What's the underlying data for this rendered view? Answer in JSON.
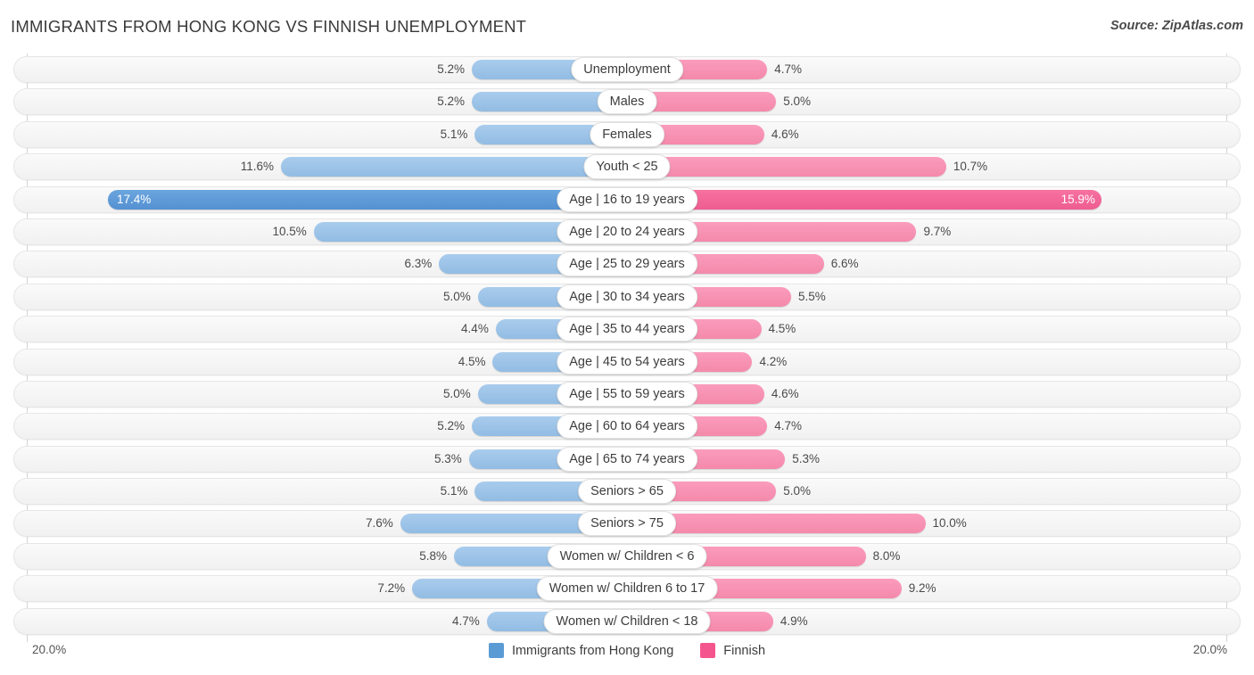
{
  "header": {
    "title": "IMMIGRANTS FROM HONG KONG VS FINNISH UNEMPLOYMENT",
    "source": "Source: ZipAtlas.com"
  },
  "legend": {
    "items": [
      {
        "label": "Immigrants from Hong Kong",
        "color": "#5b9bd5",
        "swatch": "blue"
      },
      {
        "label": "Finnish",
        "color": "#f5558d",
        "swatch": "pink"
      }
    ]
  },
  "axis": {
    "left_max_label": "20.0%",
    "right_max_label": "20.0%",
    "max_value": 20.0
  },
  "colors": {
    "left_bar": "#9dc3e6",
    "left_bar_highlight": "#5b9bd5",
    "right_bar": "#f791b3",
    "right_bar_highlight": "#f2649a",
    "track": "#f4f4f4",
    "text": "#4a4a4a"
  },
  "chart_data": {
    "type": "bar",
    "orientation": "diverging-horizontal",
    "title": "IMMIGRANTS FROM HONG KONG VS FINNISH UNEMPLOYMENT",
    "xlabel": "",
    "ylabel": "",
    "xlim": [
      20.0,
      20.0
    ],
    "grid": false,
    "legend_position": "bottom-center",
    "categories": [
      "Unemployment",
      "Males",
      "Females",
      "Youth < 25",
      "Age | 16 to 19 years",
      "Age | 20 to 24 years",
      "Age | 25 to 29 years",
      "Age | 30 to 34 years",
      "Age | 35 to 44 years",
      "Age | 45 to 54 years",
      "Age | 55 to 59 years",
      "Age | 60 to 64 years",
      "Age | 65 to 74 years",
      "Seniors > 65",
      "Seniors > 75",
      "Women w/ Children < 6",
      "Women w/ Children 6 to 17",
      "Women w/ Children < 18"
    ],
    "series": [
      {
        "name": "Immigrants from Hong Kong",
        "side": "left",
        "values": [
          5.2,
          5.2,
          5.1,
          11.6,
          17.4,
          10.5,
          6.3,
          5.0,
          4.4,
          4.5,
          5.0,
          5.2,
          5.3,
          5.1,
          7.6,
          5.8,
          7.2,
          4.7
        ],
        "labels": [
          "5.2%",
          "5.2%",
          "5.1%",
          "11.6%",
          "17.4%",
          "10.5%",
          "6.3%",
          "5.0%",
          "4.4%",
          "4.5%",
          "5.0%",
          "5.2%",
          "5.3%",
          "5.1%",
          "7.6%",
          "5.8%",
          "7.2%",
          "4.7%"
        ]
      },
      {
        "name": "Finnish",
        "side": "right",
        "values": [
          4.7,
          5.0,
          4.6,
          10.7,
          15.9,
          9.7,
          6.6,
          5.5,
          4.5,
          4.2,
          4.6,
          4.7,
          5.3,
          5.0,
          10.0,
          8.0,
          9.2,
          4.9
        ],
        "labels": [
          "4.7%",
          "5.0%",
          "4.6%",
          "10.7%",
          "15.9%",
          "9.7%",
          "6.6%",
          "5.5%",
          "4.5%",
          "4.2%",
          "4.6%",
          "4.7%",
          "5.3%",
          "5.0%",
          "10.0%",
          "8.0%",
          "9.2%",
          "4.9%"
        ]
      }
    ],
    "highlighted_row_index": 4
  }
}
